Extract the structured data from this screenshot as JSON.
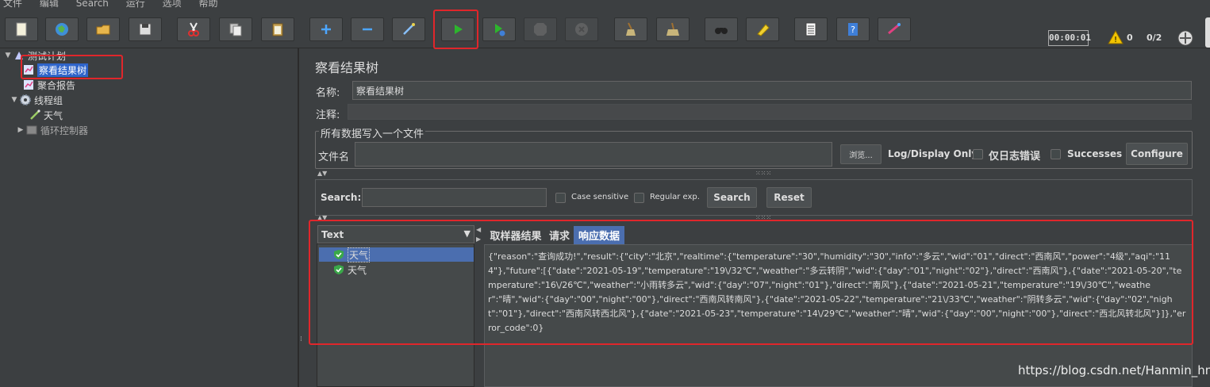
{
  "menu": [
    "文件",
    "编辑",
    "Search",
    "运行",
    "选项",
    "帮助"
  ],
  "toolbar": {
    "icons": [
      "new-icon",
      "templates-icon",
      "open-icon",
      "save-icon",
      "cut-icon",
      "copy-icon",
      "paste-icon",
      "expand-icon",
      "collapse-icon",
      "toggle-icon",
      "start-icon",
      "start-no-pause-icon",
      "stop-icon",
      "shutdown-icon",
      "clear-icon",
      "clear-all-icon",
      "search-icon",
      "reset-search-icon",
      "function-helper-icon",
      "help-icon",
      "remote-icon"
    ],
    "timer": "00:00:01",
    "warnings": "0",
    "threads": "0/2"
  },
  "tree": {
    "items": [
      {
        "label": "测试计划",
        "icon": "test-plan-icon"
      },
      {
        "label": "察看结果树",
        "icon": "listener-icon"
      },
      {
        "label": "聚合报告",
        "icon": "listener-icon"
      },
      {
        "label": "线程组",
        "icon": "gear-icon"
      },
      {
        "label": "天气",
        "icon": "sampler-icon"
      },
      {
        "label": "循环控制器",
        "icon": "controller-icon"
      }
    ]
  },
  "panel": {
    "title": "察看结果树",
    "name_label": "名称:",
    "name_value": "察看结果树",
    "comment_label": "注释:",
    "fieldset_title": "所有数据写入一个文件",
    "file_label": "文件名",
    "browse_button": "浏览...",
    "log_display_label": "Log/Display Only:",
    "errors_only_label": "仅日志错误",
    "successes_label": "Successes",
    "configure_button": "Configure"
  },
  "search": {
    "label": "Search:",
    "case_sensitive": "Case sensitive",
    "regular_exp": "Regular exp.",
    "search_button": "Search",
    "reset_button": "Reset"
  },
  "results": {
    "renderer": "Text",
    "rows": [
      "天气",
      "天气"
    ],
    "tabs": [
      "取样器结果",
      "请求",
      "响应数据"
    ],
    "response_text": "{\"reason\":\"查询成功!\",\"result\":{\"city\":\"北京\",\"realtime\":{\"temperature\":\"30\",\"humidity\":\"30\",\"info\":\"多云\",\"wid\":\"01\",\"direct\":\"西南风\",\"power\":\"4级\",\"aqi\":\"114\"},\"future\":[{\"date\":\"2021-05-19\",\"temperature\":\"19\\/32℃\",\"weather\":\"多云转阴\",\"wid\":{\"day\":\"01\",\"night\":\"02\"},\"direct\":\"西南风\"},{\"date\":\"2021-05-20\",\"temperature\":\"16\\/26℃\",\"weather\":\"小雨转多云\",\"wid\":{\"day\":\"07\",\"night\":\"01\"},\"direct\":\"南风\"},{\"date\":\"2021-05-21\",\"temperature\":\"19\\/30℃\",\"weather\":\"晴\",\"wid\":{\"day\":\"00\",\"night\":\"00\"},\"direct\":\"西南风转南风\"},{\"date\":\"2021-05-22\",\"temperature\":\"21\\/33℃\",\"weather\":\"阴转多云\",\"wid\":{\"day\":\"02\",\"night\":\"01\"},\"direct\":\"西南风转西北风\"},{\"date\":\"2021-05-23\",\"temperature\":\"14\\/29℃\",\"weather\":\"晴\",\"wid\":{\"day\":\"00\",\"night\":\"00\"},\"direct\":\"西北风转北风\"}]},\"error_code\":0}"
  },
  "watermark": "https://blog.csdn.net/Hanmin_hm",
  "colors": {
    "highlight": "#e0262b",
    "selection": "#2f65ca",
    "background": "#3c3f41"
  }
}
